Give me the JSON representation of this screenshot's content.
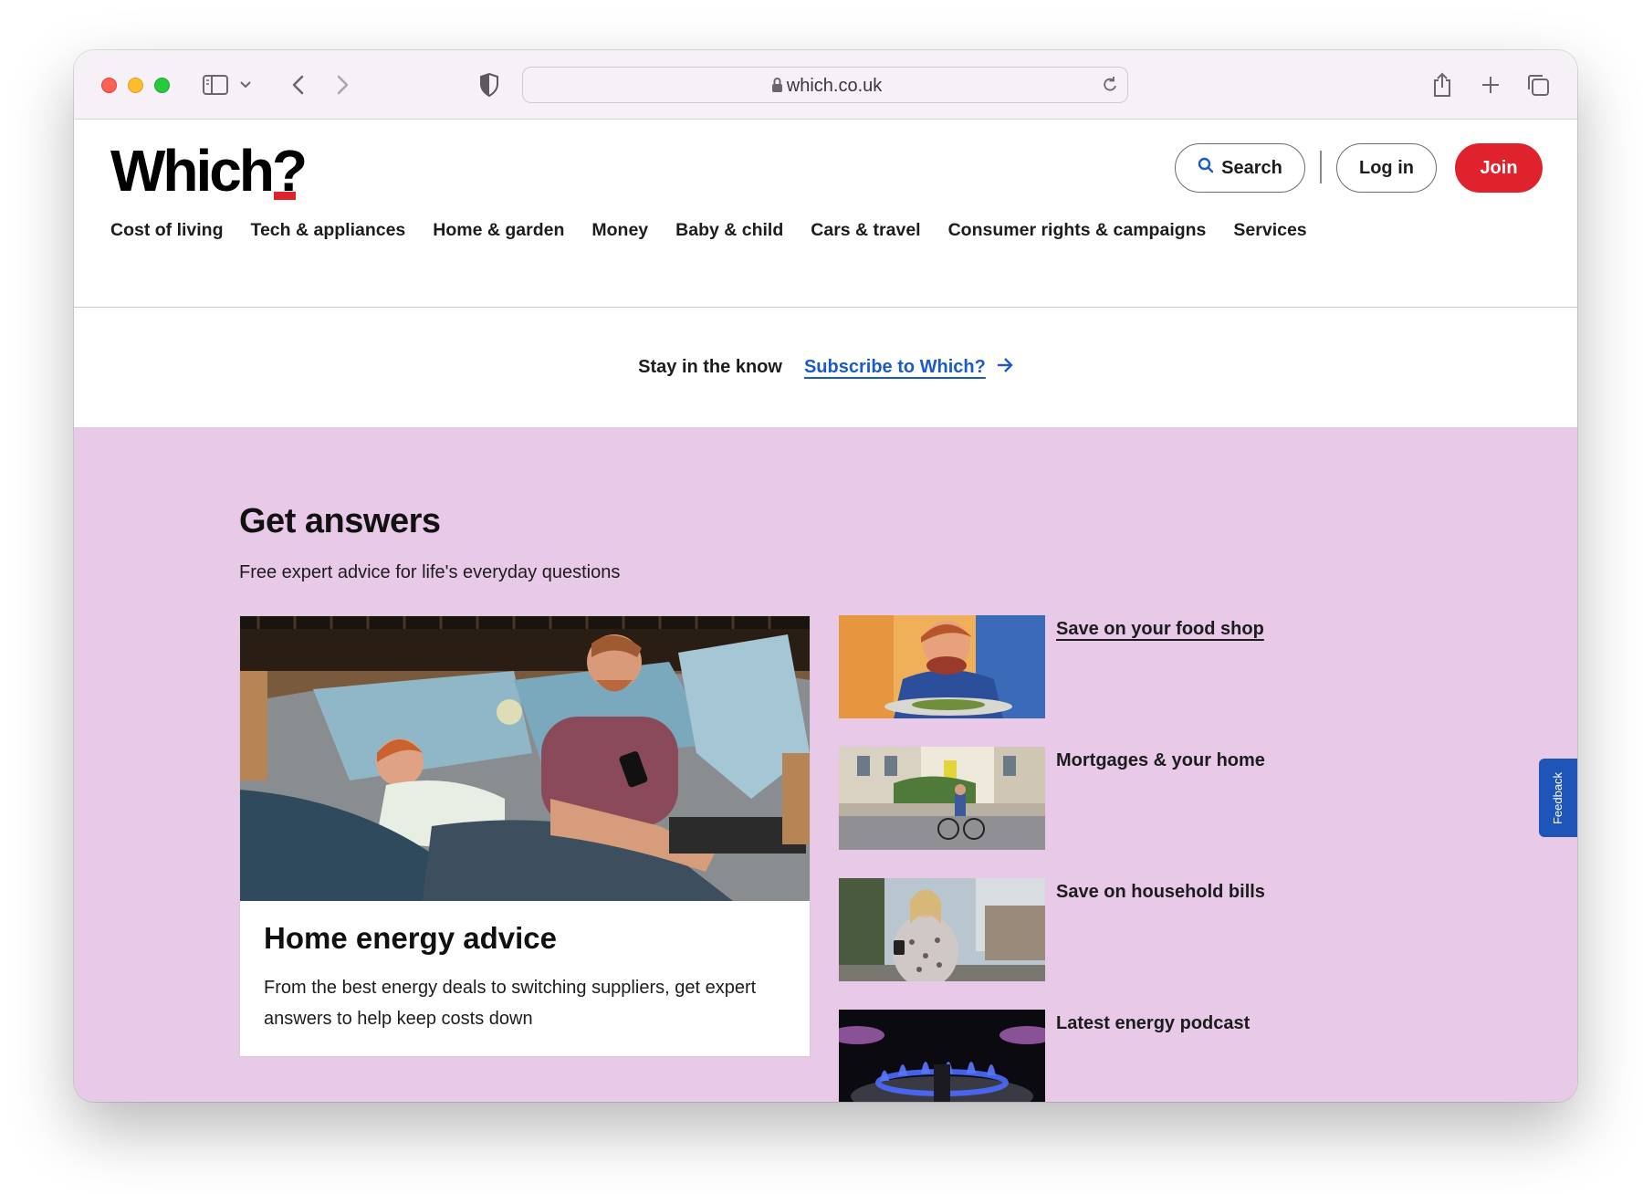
{
  "browser": {
    "url": "which.co.uk"
  },
  "site": {
    "logo_text": "Which",
    "logo_mark": "?",
    "brand_color": "#e0222c",
    "search_label": "Search",
    "login_label": "Log in",
    "join_label": "Join",
    "nav": [
      "Cost of living",
      "Tech & appliances",
      "Home & garden",
      "Money",
      "Baby & child",
      "Cars & travel",
      "Consumer rights & campaigns",
      "Services"
    ]
  },
  "subscribe": {
    "prompt": "Stay in the know",
    "link_label": "Subscribe to Which?"
  },
  "answers": {
    "background": "#e9c9e8",
    "title": "Get answers",
    "subtitle": "Free expert advice for life's everyday questions",
    "feature": {
      "title": "Home energy advice",
      "text": "From the best energy deals to switching suppliers, get expert answers to help keep costs down"
    },
    "items": [
      {
        "label": "Save on your food shop"
      },
      {
        "label": "Mortgages & your home"
      },
      {
        "label": "Save on household bills"
      },
      {
        "label": "Latest energy podcast"
      }
    ]
  },
  "feedback_label": "Feedback"
}
